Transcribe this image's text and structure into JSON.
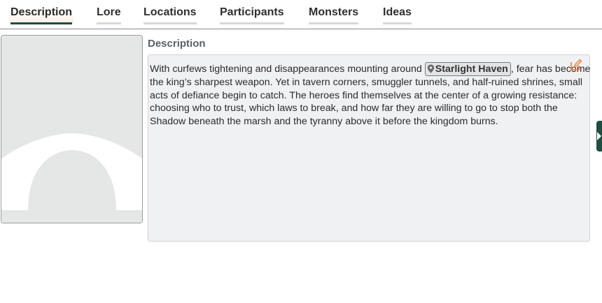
{
  "tabs": [
    {
      "label": "Description",
      "active": true
    },
    {
      "label": "Lore",
      "active": false
    },
    {
      "label": "Locations",
      "active": false
    },
    {
      "label": "Participants",
      "active": false
    },
    {
      "label": "Monsters",
      "active": false
    },
    {
      "label": "Ideas",
      "active": false
    }
  ],
  "section_title": "Description",
  "description": {
    "text_before": "With curfews tightening and disappearances mounting around ",
    "location_link": "Starlight Haven",
    "text_after": ", fear has become the king’s sharpest weapon. Yet in tavern corners, smuggler tunnels, and half-ruined shrines, small acts of defiance begin to catch. The heroes find themselves at the center of a growing resistance: choosing who to trust, which laws to break, and how far they are willing to go to stop both the Shadow beneath the marsh and the tyranny above it before the kingdom burns."
  },
  "icons": {
    "location_pin": "map-pin-icon",
    "edit": "edit-icon",
    "panel_toggle": "chevron-right-icon",
    "portrait_placeholder": "user-avatar-placeholder"
  },
  "colors": {
    "active_tab_underline": "#1f4d40",
    "edit_icon": "#f08a4b",
    "side_handle": "#1f4d40"
  }
}
